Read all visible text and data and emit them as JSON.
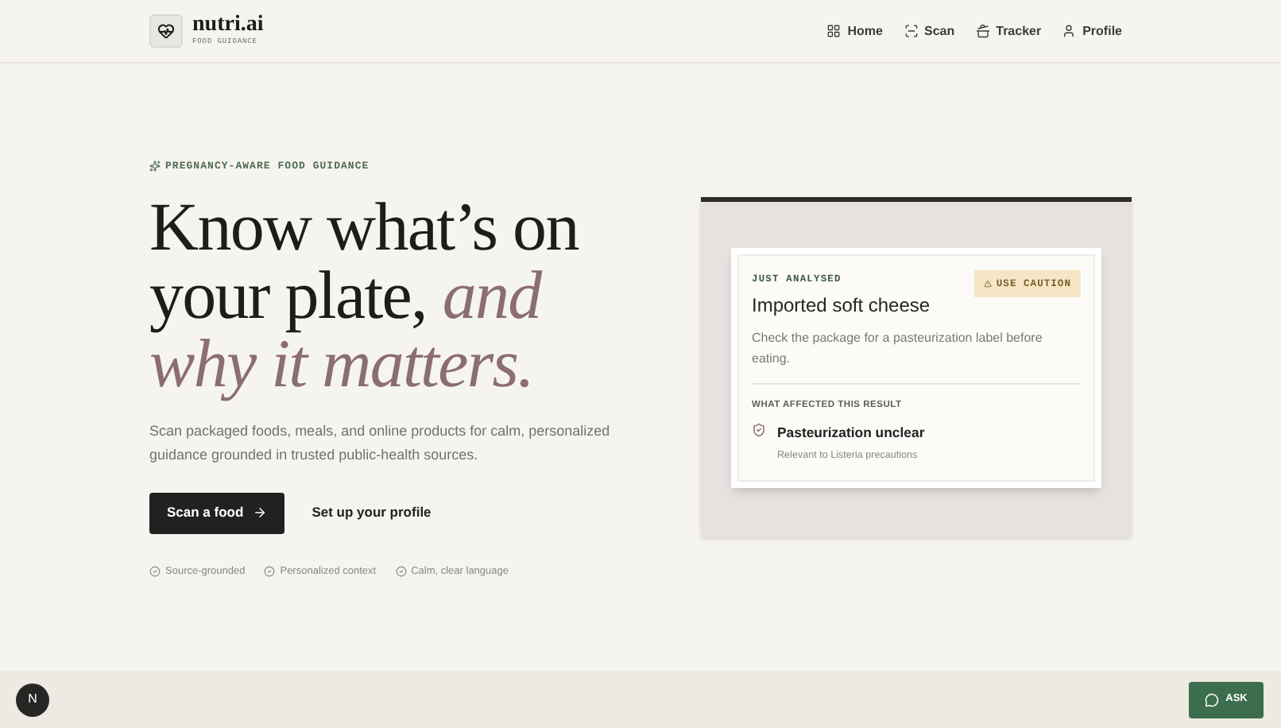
{
  "brand": {
    "name": "nutri.ai",
    "tagline": "FOOD GUIDANCE"
  },
  "nav": [
    {
      "label": "Home"
    },
    {
      "label": "Scan"
    },
    {
      "label": "Tracker"
    },
    {
      "label": "Profile"
    }
  ],
  "hero": {
    "eyebrow": "PREGNANCY-AWARE FOOD GUIDANCE",
    "headline": "Know what’s on your plate,",
    "headline_accent": "and why it matters.",
    "description": "Scan packaged foods, meals, and online products for calm, personalized guidance grounded in trusted public-health sources.",
    "primary_button": "Scan a food",
    "secondary_button": "Set up your profile",
    "features": [
      "Source-grounded",
      "Personalized context",
      "Calm, clear language"
    ]
  },
  "result_card": {
    "label": "JUST ANALYSED",
    "badge": "USE CAUTION",
    "title": "Imported soft cheese",
    "message": "Check the package for a pasteurization label before eating.",
    "section_title": "WHAT AFFECTED THIS RESULT",
    "factor_title": "Pasteurization unclear",
    "factor_detail": "Relevant to Listeria precautions"
  },
  "dev_indicator": "N",
  "ask_button": "ASK"
}
